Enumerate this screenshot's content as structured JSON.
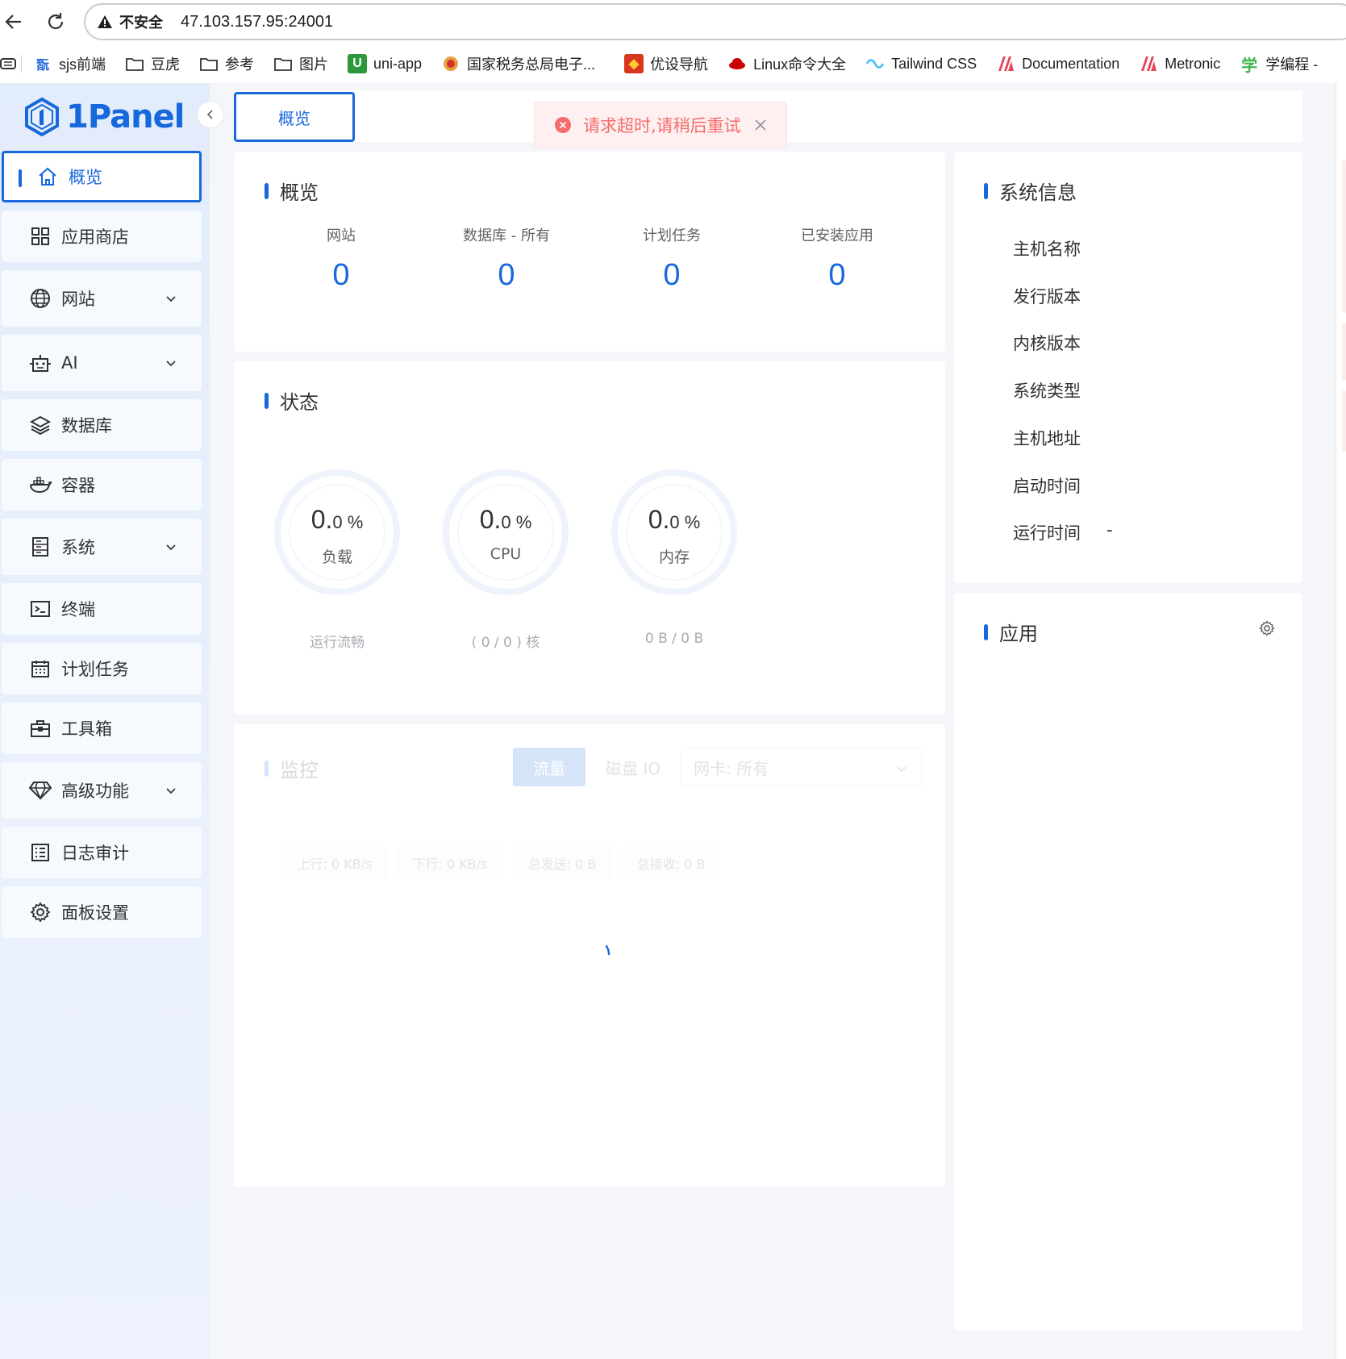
{
  "browser": {
    "insecure_label": "不安全",
    "url": "47.103.157.95:24001",
    "bookmarks": [
      {
        "label": "sjs前端",
        "icon": "sjs-logo-icon"
      },
      {
        "label": "豆虎",
        "icon": "folder-icon"
      },
      {
        "label": "参考",
        "icon": "folder-icon"
      },
      {
        "label": "图片",
        "icon": "folder-icon"
      },
      {
        "label": "uni-app",
        "icon": "uniapp-logo-icon"
      },
      {
        "label": "国家税务总局电子...",
        "icon": "tax-emblem-icon"
      },
      {
        "label": "优设导航",
        "icon": "uisdc-logo-icon"
      },
      {
        "label": "Linux命令大全",
        "icon": "redhat-logo-icon"
      },
      {
        "label": "Tailwind CSS",
        "icon": "tailwind-logo-icon"
      },
      {
        "label": "Documentation",
        "icon": "metronic-logo-icon"
      },
      {
        "label": "Metronic",
        "icon": "metronic-logo-icon"
      },
      {
        "label": "学编程 -",
        "icon": "xue-logo-icon"
      }
    ]
  },
  "app": {
    "logo_text": "1Panel",
    "accent": "#1668dc",
    "error_color": "#f56c6c"
  },
  "sidebar": {
    "items": [
      {
        "label": "概览",
        "icon": "home-icon",
        "active": true
      },
      {
        "label": "应用商店",
        "icon": "apps-grid-icon"
      },
      {
        "label": "网站",
        "icon": "globe-icon",
        "expandable": true
      },
      {
        "label": "AI",
        "icon": "robot-icon",
        "expandable": true
      },
      {
        "label": "数据库",
        "icon": "layers-icon"
      },
      {
        "label": "容器",
        "icon": "docker-icon"
      },
      {
        "label": "系统",
        "icon": "server-icon",
        "expandable": true
      },
      {
        "label": "终端",
        "icon": "terminal-icon"
      },
      {
        "label": "计划任务",
        "icon": "calendar-icon"
      },
      {
        "label": "工具箱",
        "icon": "toolbox-icon"
      },
      {
        "label": "高级功能",
        "icon": "diamond-icon",
        "expandable": true
      },
      {
        "label": "日志审计",
        "icon": "log-list-icon"
      },
      {
        "label": "面板设置",
        "icon": "gear-icon"
      }
    ]
  },
  "tabs": [
    {
      "label": "概览",
      "active": true
    }
  ],
  "toast": {
    "message": "请求超时,请稍后重试",
    "type": "error"
  },
  "overview": {
    "title": "概览",
    "stats": [
      {
        "label": "网站",
        "value": "0"
      },
      {
        "label": "数据库 - 所有",
        "value": "0"
      },
      {
        "label": "计划任务",
        "value": "0"
      },
      {
        "label": "已安装应用",
        "value": "0"
      }
    ]
  },
  "status": {
    "title": "状态",
    "gauges": [
      {
        "value": "0.",
        "decimal": "0 %",
        "label": "负载",
        "sub": "运行流畅",
        "percent": 0
      },
      {
        "value": "0.",
        "decimal": "0 %",
        "label": "CPU",
        "sub": "( 0 / 0 ) 核",
        "percent": 0
      },
      {
        "value": "0.",
        "decimal": "0 %",
        "label": "内存",
        "sub": "0 B / 0 B",
        "percent": 0
      }
    ]
  },
  "monitor": {
    "title": "监控",
    "segments": [
      "流量",
      "磁盘 IO"
    ],
    "active_segment": "流量",
    "nic_select": "网卡: 所有",
    "pills": [
      "上行: 0 KB/s",
      "下行: 0 KB/s",
      "总发送: 0 B",
      "总接收: 0 B"
    ]
  },
  "system_info": {
    "title": "系统信息",
    "rows": [
      {
        "label": "主机名称",
        "value": ""
      },
      {
        "label": "发行版本",
        "value": ""
      },
      {
        "label": "内核版本",
        "value": ""
      },
      {
        "label": "系统类型",
        "value": ""
      },
      {
        "label": "主机地址",
        "value": ""
      },
      {
        "label": "启动时间",
        "value": ""
      },
      {
        "label": "运行时间",
        "value": "-"
      }
    ]
  },
  "apps_card": {
    "title": "应用",
    "settings_icon": "gear-icon"
  }
}
